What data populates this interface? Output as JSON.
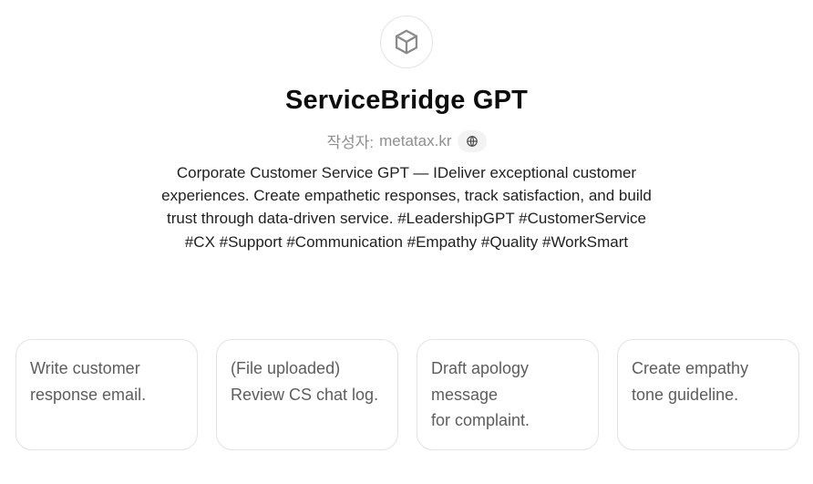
{
  "gpt": {
    "title": "ServiceBridge GPT",
    "byline_prefix": "작성자:",
    "author": "metatax.kr",
    "description": "Corporate Customer Service GPT — IDeliver exceptional customer experiences. Create empathetic responses, track satisfaction, and build trust through data-driven service. #LeadershipGPT #CustomerService #CX #Support #Communication #Empathy #Quality #WorkSmart",
    "avatar_icon": "cube-icon",
    "website_icon": "globe-icon"
  },
  "starters": [
    {
      "lines": [
        "Write customer",
        "response email."
      ]
    },
    {
      "lines": [
        "(File uploaded)",
        "Review CS chat log."
      ]
    },
    {
      "lines": [
        "Draft apology",
        "message",
        "for complaint."
      ]
    },
    {
      "lines": [
        "Create empathy",
        "tone guideline."
      ]
    }
  ],
  "colors": {
    "text_primary": "#0d0d0d",
    "text_muted": "#8f8f8f",
    "starter_text": "#5d5d5d",
    "border": "#e3e3e3"
  }
}
